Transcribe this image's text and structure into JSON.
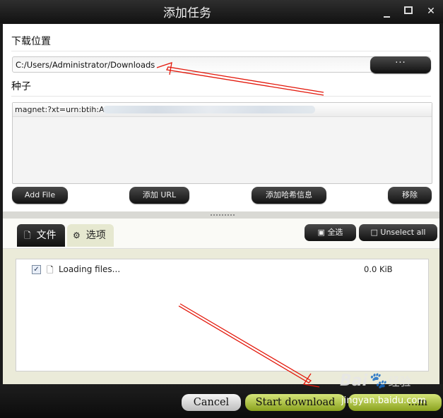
{
  "window": {
    "title": "添加任务",
    "controls": [
      "minimize-icon",
      "maximize-icon",
      "close-icon"
    ]
  },
  "download_location": {
    "label": "下载位置",
    "path": "C:/Users/Administrator/Downloads",
    "browse_label": "···"
  },
  "seed": {
    "label": "种子",
    "text": "magnet:?xt=urn:btih:A"
  },
  "seed_buttons": {
    "add_file": "Add File",
    "add_url": "添加 URL",
    "add_hash": "添加哈希信息",
    "remove": "移除"
  },
  "tabs": [
    {
      "label": "文件",
      "icon": "file-icon",
      "active": true
    },
    {
      "label": "选项",
      "icon": "gear-icon",
      "active": false
    }
  ],
  "file_actions": {
    "select_all": "全选",
    "unselect_all": "Unselect all"
  },
  "files": [
    {
      "checked": true,
      "name": "Loading files...",
      "size": "0.0 KiB"
    }
  ],
  "footer": {
    "cancel": "Cancel",
    "start": "Start download",
    "third_partial": "...m"
  },
  "watermark": {
    "brand_a": "Bai",
    "brand_b": "经验",
    "url": "jingyan.baidu.com"
  },
  "annotation_color": "#e3170a"
}
